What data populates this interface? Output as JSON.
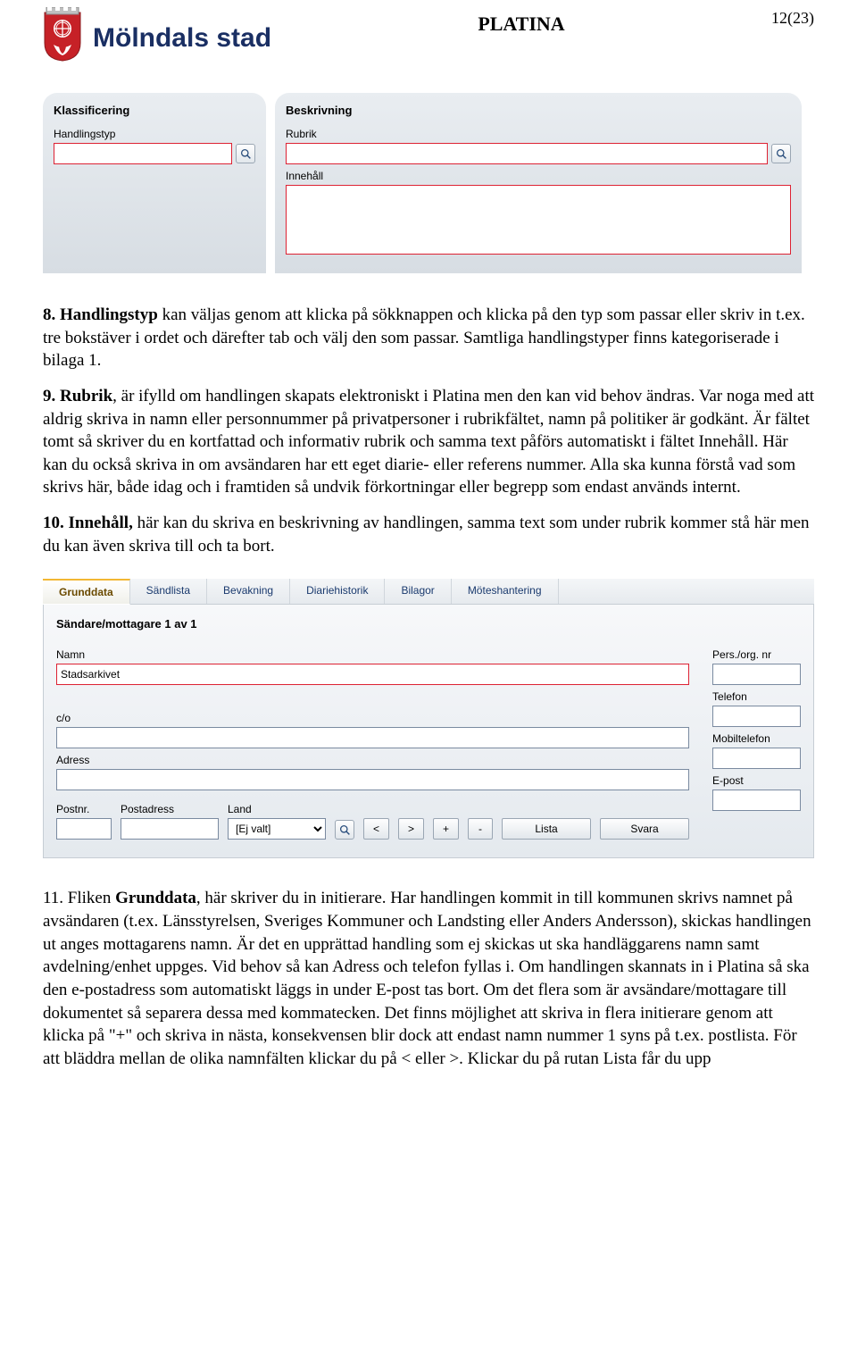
{
  "header": {
    "logo_text": "Mölndals stad",
    "center_title": "PLATINA",
    "page_number": "12(23)"
  },
  "panel_klassificering": {
    "title": "Klassificering",
    "handlingstyp_label": "Handlingstyp",
    "handlingstyp_value": ""
  },
  "panel_beskrivning": {
    "title": "Beskrivning",
    "rubrik_label": "Rubrik",
    "rubrik_value": "",
    "innehall_label": "Innehåll",
    "innehall_value": ""
  },
  "para8_lead": "8.  Handlingstyp",
  "para8_rest": " kan väljas genom att klicka på sökknappen och klicka på den typ som passar eller skriv in t.ex. tre bokstäver i ordet och därefter tab och välj den som passar. Samtliga handlingstyper finns kategoriserade i bilaga 1.",
  "para9_lead": "9.  Rubrik",
  "para9_rest": ", är ifylld om handlingen skapats elektroniskt i Platina men den kan vid behov ändras. Var noga med att aldrig skriva in namn eller personnummer på privatpersoner i rubrikfältet, namn på politiker är godkänt. Är fältet tomt så skriver du en kortfattad och informativ rubrik och samma text påförs automatiskt i fältet Innehåll. Här kan du också skriva in om avsändaren har ett eget diarie- eller referens nummer. Alla ska kunna förstå vad som skrivs här, både idag och i framtiden så undvik förkortningar eller begrepp som endast används internt.",
  "para10_lead": "10. Innehåll,",
  "para10_rest": " här kan du skriva en beskrivning av handlingen, samma text som under rubrik kommer stå här men du kan även skriva till och ta bort.",
  "tabs": {
    "items": [
      "Grunddata",
      "Sändlista",
      "Bevakning",
      "Diariehistorik",
      "Bilagor",
      "Möteshantering"
    ],
    "active_index": 0
  },
  "sandare": {
    "section_title": "Sändare/mottagare 1 av 1",
    "namn_label": "Namn",
    "namn_value": "Stadsarkivet",
    "co_label": "c/o",
    "co_value": "",
    "adress_label": "Adress",
    "adress_value": "",
    "postnr_label": "Postnr.",
    "postnr_value": "",
    "postadress_label": "Postadress",
    "postadress_value": "",
    "land_label": "Land",
    "land_value": "[Ej valt]",
    "persorg_label": "Pers./org. nr",
    "persorg_value": "",
    "telefon_label": "Telefon",
    "telefon_value": "",
    "mobil_label": "Mobiltelefon",
    "mobil_value": "",
    "epost_label": "E-post",
    "epost_value": "",
    "btn_prev": "<",
    "btn_next": ">",
    "btn_plus": "+",
    "btn_minus": "-",
    "btn_lista": "Lista",
    "btn_svara": "Svara"
  },
  "para11_a": "11.  Fliken ",
  "para11_b": "Grunddata",
  "para11_c": ", här skriver du in initierare. Har handlingen kommit in till kommunen skrivs namnet på avsändaren (t.ex. Länsstyrelsen, Sveriges Kommuner och Landsting eller Anders Andersson), skickas handlingen ut anges mottagarens namn. Är det en upprättad handling som ej skickas ut ska handläggarens namn samt avdelning/enhet uppges. Vid behov så kan Adress och telefon fyllas i. Om handlingen skannats in i Platina så ska den e-postadress som automatiskt läggs in under E-post tas bort. Om det flera som är avsändare/mottagare till dokumentet så separera dessa med kommatecken. Det finns möjlighet att skriva in flera initierare genom att klicka på \"+\" och skriva in nästa, konsekvensen blir dock att endast namn nummer 1 syns på t.ex. postlista. För att bläddra mellan de olika namnfälten klickar du på < eller >. Klickar du på rutan Lista får du upp"
}
